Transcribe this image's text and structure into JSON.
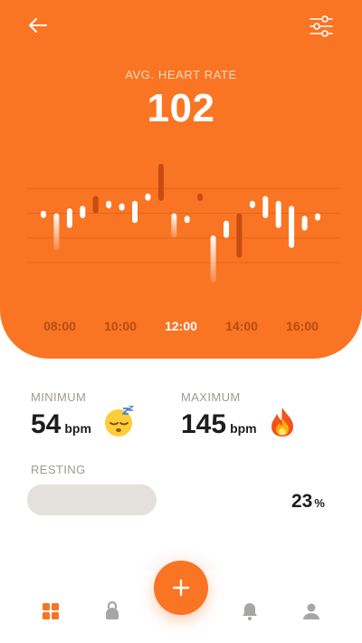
{
  "header": {
    "back_icon": "arrow-left-icon",
    "filter_icon": "sliders-icon",
    "label": "AVG. HEART RATE",
    "value": "102"
  },
  "chart_data": {
    "type": "bar",
    "description_unit": "bpm",
    "x_labels": [
      "08:00",
      "10:00",
      "12:00",
      "14:00",
      "16:00"
    ],
    "active_label": "12:00",
    "bars": [
      {
        "min": 102,
        "max": 100,
        "style": "white"
      },
      {
        "min": 86,
        "max": 101,
        "style": "fade"
      },
      {
        "min": 95,
        "max": 103,
        "style": "white"
      },
      {
        "min": 99,
        "max": 104,
        "style": "white"
      },
      {
        "min": 101,
        "max": 108,
        "style": "dark"
      },
      {
        "min": 103,
        "max": 106,
        "style": "white"
      },
      {
        "min": 103,
        "max": 105,
        "style": "white"
      },
      {
        "min": 97,
        "max": 106,
        "style": "white"
      },
      {
        "min": 107,
        "max": 109,
        "style": "white"
      },
      {
        "min": 106,
        "max": 121,
        "style": "dark"
      },
      {
        "min": 91,
        "max": 101,
        "style": "fade"
      },
      {
        "min": 98,
        "max": 100,
        "style": "white"
      },
      {
        "min": 106,
        "max": 109,
        "style": "dark"
      },
      {
        "min": 73,
        "max": 92,
        "style": "fade"
      },
      {
        "min": 91,
        "max": 98,
        "style": "white"
      },
      {
        "min": 83,
        "max": 101,
        "style": "dark"
      },
      {
        "min": 104,
        "max": 106,
        "style": "white"
      },
      {
        "min": 99,
        "max": 108,
        "style": "white"
      },
      {
        "min": 95,
        "max": 106,
        "style": "white"
      },
      {
        "min": 87,
        "max": 104,
        "style": "white"
      },
      {
        "min": 94,
        "max": 100,
        "style": "white"
      },
      {
        "min": 100,
        "max": 101,
        "style": "white"
      }
    ],
    "ylim": [
      70,
      125
    ],
    "gridlines": [
      81,
      91,
      101,
      111
    ]
  },
  "stats": {
    "minimum": {
      "title": "MINIMUM",
      "value": "54",
      "unit": "bpm",
      "emoji": "sleeping-face-icon"
    },
    "maximum": {
      "title": "MAXIMUM",
      "value": "145",
      "unit": "bpm",
      "emoji": "fire-icon"
    },
    "resting": {
      "title": "RESTING",
      "value": "23",
      "unit": "%",
      "fill_fraction": 0.23
    }
  },
  "nav": {
    "items": [
      "dashboard-icon",
      "kettlebell-icon",
      "add-icon",
      "bell-icon",
      "user-icon"
    ],
    "active": "dashboard-icon"
  },
  "colors": {
    "accent": "#f97423",
    "accent_dark": "#c84c12",
    "muted_text": "#a09a96",
    "track": "#e4e0dc"
  }
}
